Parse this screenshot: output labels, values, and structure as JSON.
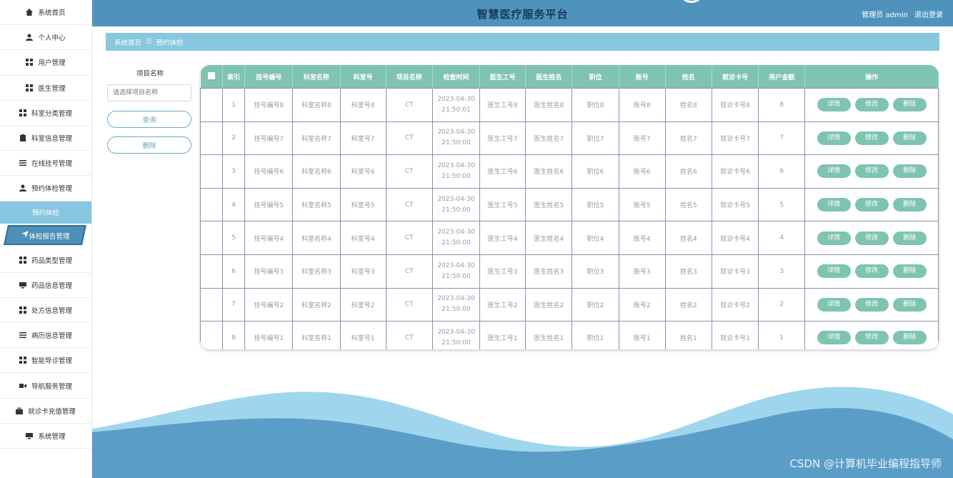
{
  "app": {
    "title": "智慧医疗服务平台",
    "user_label": "管理员 admin",
    "logout_label": "退出登录"
  },
  "sidebar": {
    "items": [
      {
        "label": "系统首页",
        "icon": "home-icon"
      },
      {
        "label": "个人中心",
        "icon": "user-icon"
      },
      {
        "label": "用户管理",
        "icon": "grid-icon"
      },
      {
        "label": "医生管理",
        "icon": "grid-icon"
      },
      {
        "label": "科室分类管理",
        "icon": "grid-icon"
      },
      {
        "label": "科室信息管理",
        "icon": "clipboard-icon"
      },
      {
        "label": "在线挂号管理",
        "icon": "list-icon"
      },
      {
        "label": "预约体检管理",
        "icon": "user-icon"
      }
    ],
    "sub_item": "预约体检",
    "active_item": {
      "label": "体检报告管理",
      "icon": "send-icon"
    },
    "items_after": [
      {
        "label": "药品类型管理",
        "icon": "grid-icon"
      },
      {
        "label": "药品信息管理",
        "icon": "monitor-icon"
      },
      {
        "label": "处方信息管理",
        "icon": "grid-icon"
      },
      {
        "label": "病历信息管理",
        "icon": "list-icon"
      },
      {
        "label": "智能导诊管理",
        "icon": "grid-icon"
      },
      {
        "label": "导航服务管理",
        "icon": "video-icon"
      },
      {
        "label": "就诊卡充值管理",
        "icon": "briefcase-icon"
      },
      {
        "label": "系统管理",
        "icon": "monitor-icon"
      }
    ]
  },
  "breadcrumb": {
    "home": "系统首页",
    "separator": "☰",
    "current": "预约体检"
  },
  "search": {
    "label": "项目名称",
    "placeholder": "请选择项目名称",
    "query_button": "查询",
    "delete_button": "删除"
  },
  "table": {
    "headers": [
      "索引",
      "挂号编号",
      "科室名称",
      "科室号",
      "项目名称",
      "检查时间",
      "医生工号",
      "医生姓名",
      "职位",
      "账号",
      "姓名",
      "就诊卡号",
      "用户金额",
      "操作"
    ],
    "action_labels": {
      "detail": "详情",
      "edit": "修改",
      "delete": "删除"
    },
    "rows": [
      {
        "index": "1",
        "reg_no": "挂号编号8",
        "dept_name": "科室名称8",
        "dept_no": "科室号8",
        "project": "CT",
        "date": "2023-04-30",
        "time": "21:50:01",
        "doc_no": "医生工号8",
        "doc_name": "医生姓名8",
        "position": "职位8",
        "account": "账号8",
        "name": "姓名8",
        "card_no": "就诊卡号8",
        "amount": "8"
      },
      {
        "index": "2",
        "reg_no": "挂号编号7",
        "dept_name": "科室名称7",
        "dept_no": "科室号7",
        "project": "CT",
        "date": "2023-04-30",
        "time": "21:50:00",
        "doc_no": "医生工号7",
        "doc_name": "医生姓名7",
        "position": "职位7",
        "account": "账号7",
        "name": "姓名7",
        "card_no": "就诊卡号7",
        "amount": "7"
      },
      {
        "index": "3",
        "reg_no": "挂号编号6",
        "dept_name": "科室名称6",
        "dept_no": "科室号6",
        "project": "CT",
        "date": "2023-04-30",
        "time": "21:50:00",
        "doc_no": "医生工号6",
        "doc_name": "医生姓名6",
        "position": "职位6",
        "account": "账号6",
        "name": "姓名6",
        "card_no": "就诊卡号6",
        "amount": "6"
      },
      {
        "index": "4",
        "reg_no": "挂号编号5",
        "dept_name": "科室名称5",
        "dept_no": "科室号5",
        "project": "CT",
        "date": "2023-04-30",
        "time": "21:50:00",
        "doc_no": "医生工号5",
        "doc_name": "医生姓名5",
        "position": "职位5",
        "account": "账号5",
        "name": "姓名5",
        "card_no": "就诊卡号5",
        "amount": "5"
      },
      {
        "index": "5",
        "reg_no": "挂号编号4",
        "dept_name": "科室名称4",
        "dept_no": "科室号4",
        "project": "CT",
        "date": "2023-04-30",
        "time": "21:50:00",
        "doc_no": "医生工号4",
        "doc_name": "医生姓名4",
        "position": "职位4",
        "account": "账号4",
        "name": "姓名4",
        "card_no": "就诊卡号4",
        "amount": "4"
      },
      {
        "index": "6",
        "reg_no": "挂号编号3",
        "dept_name": "科室名称3",
        "dept_no": "科室号3",
        "project": "CT",
        "date": "2023-04-30",
        "time": "21:50:00",
        "doc_no": "医生工号3",
        "doc_name": "医生姓名3",
        "position": "职位3",
        "account": "账号3",
        "name": "姓名3",
        "card_no": "就诊卡号3",
        "amount": "3"
      },
      {
        "index": "7",
        "reg_no": "挂号编号2",
        "dept_name": "科室名称2",
        "dept_no": "科室号2",
        "project": "CT",
        "date": "2023-04-30",
        "time": "21:50:00",
        "doc_no": "医生工号2",
        "doc_name": "医生姓名2",
        "position": "职位2",
        "account": "账号2",
        "name": "姓名2",
        "card_no": "就诊卡号2",
        "amount": "2"
      },
      {
        "index": "8",
        "reg_no": "挂号编号1",
        "dept_name": "科室名称1",
        "dept_no": "科室号1",
        "project": "CT",
        "date": "2023-04-30",
        "time": "21:50:00",
        "doc_no": "医生工号1",
        "doc_name": "医生姓名1",
        "position": "职位1",
        "account": "账号1",
        "name": "姓名1",
        "card_no": "就诊卡号1",
        "amount": "1"
      }
    ]
  },
  "watermark": "CSDN @计算机毕业编程指导师",
  "colors": {
    "header": "#4f93bd",
    "accent": "#87c7df",
    "table_header": "#7fc4b2",
    "wave_dark": "#5a9ec8",
    "wave_light": "#9fd6ee"
  }
}
